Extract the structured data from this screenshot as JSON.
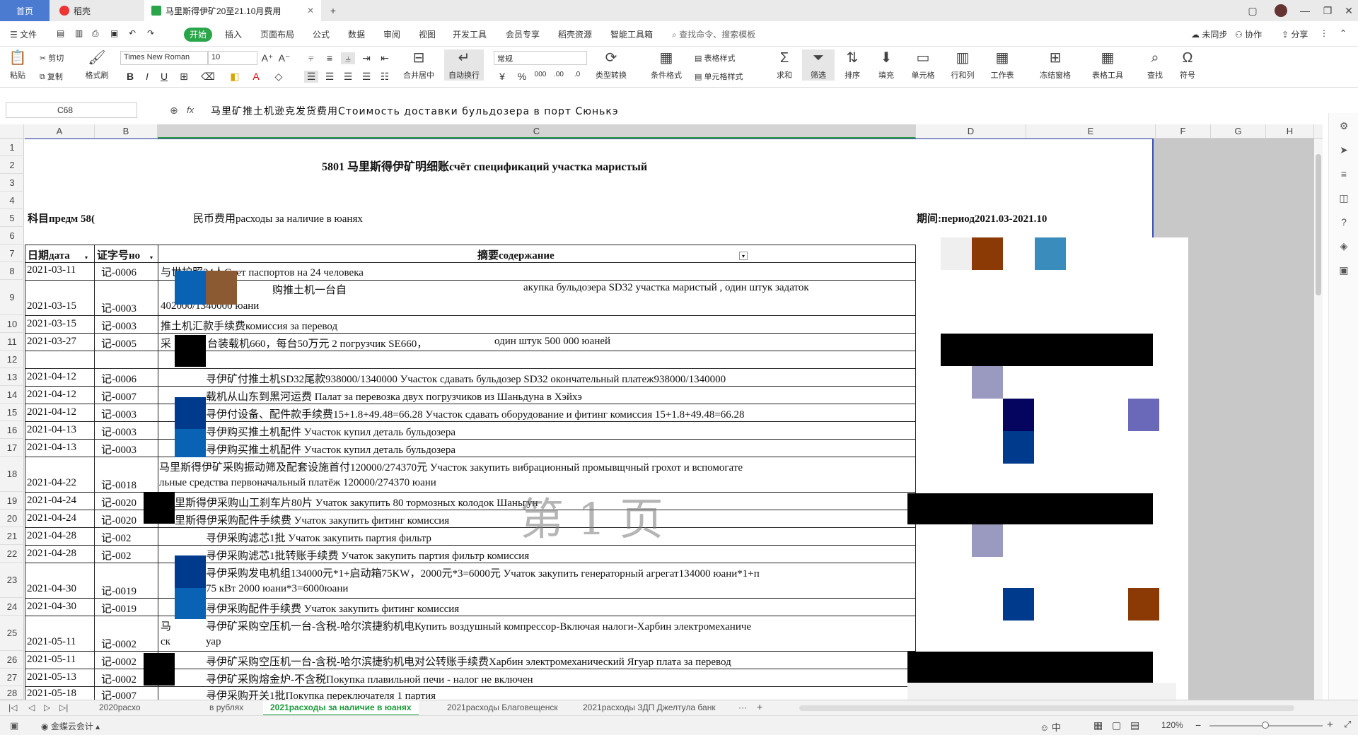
{
  "titlebar": {
    "tabs": [
      {
        "label": "首页"
      },
      {
        "label": "稻壳"
      },
      {
        "label": "马里斯得伊矿20至21.10月费用"
      }
    ],
    "new_tab": "+"
  },
  "menubar": {
    "file": "文件",
    "start": "开始",
    "items": [
      "插入",
      "页面布局",
      "公式",
      "数据",
      "审阅",
      "视图",
      "开发工具",
      "会员专享",
      "稻壳资源",
      "智能工具箱"
    ],
    "search_placeholder": "查找命令、搜索模板",
    "sync": "未同步",
    "collab": "协作",
    "share": "分享"
  },
  "toolbar": {
    "paste": "粘贴",
    "cut": "剪切",
    "copy": "复制",
    "format_painter": "格式刷",
    "font_name": "Times New Roman",
    "font_size": "10",
    "merge": "合并居中",
    "wrap": "自动换行",
    "number_format": "常规",
    "type_convert": "类型转换",
    "cond_format": "条件格式",
    "table_style": "表格样式",
    "cell_style": "单元格样式",
    "sum": "求和",
    "filter": "筛选",
    "sort": "排序",
    "fill": "填充",
    "cell": "单元格",
    "row_col": "行和列",
    "worksheet": "工作表",
    "freeze": "冻结窗格",
    "table_tools": "表格工具",
    "find": "查找",
    "symbol": "符号"
  },
  "formula": {
    "cell_ref": "C68",
    "fx": "fx",
    "content": "马里矿推土机逊克发货费用Стоимость доставки бульдозера в порт Сюнькэ"
  },
  "columns": [
    "A",
    "B",
    "C",
    "D",
    "E",
    "F",
    "G",
    "H"
  ],
  "rows": [
    "1",
    "2",
    "3",
    "4",
    "5",
    "6",
    "7",
    "8",
    "9",
    "10",
    "11",
    "12",
    "13",
    "14",
    "15",
    "16",
    "17",
    "18",
    "19",
    "20",
    "21",
    "22",
    "23",
    "24",
    "25",
    "26",
    "27",
    "28"
  ],
  "sheet": {
    "title": "5801 马里斯得伊矿明细账счёт спецификаций участка маристый",
    "subject": "科目предм 58(",
    "subject_rest": "民币费用расходы за наличие в юанях",
    "period": "期间:период2021.03-2021.10",
    "headers": {
      "date": "日期дата",
      "voucher": "证字号но",
      "summary": "摘要содержание"
    },
    "entries": [
      {
        "date": "2021-03-11",
        "voucher": "记-0006",
        "text": "与世护照24人Счет паспортов на 24 человека"
      },
      {
        "date": "2021-03-15",
        "voucher": "记-0003",
        "text": "购推土机一台自",
        "text2": "акупка бульдозера SD32 участка маристый ,  один штук задаток",
        "line2": "402000/1340000 юани"
      },
      {
        "date": "2021-03-15",
        "voucher": "记-0003",
        "text": "推土机汇款手续费комиссия за перевод"
      },
      {
        "date": "2021-03-27",
        "voucher": "记-0005",
        "text": "采",
        "text2": "台装载机660，每台50万元 2 погрузчик SE660，",
        "text3": "один  штук 500 000 юаней"
      },
      {
        "date": "",
        "voucher": "",
        "text": ""
      },
      {
        "date": "2021-04-12",
        "voucher": "记-0006",
        "text": "寻伊矿付推土机SD32尾款938000/1340000  Участок сдавать бульдозер SD32 окончательный платеж938000/1340000"
      },
      {
        "date": "2021-04-12",
        "voucher": "记-0007",
        "text": "载机从山东到黑河运费 Палат за перевозка двух погрузчиков из Шаньдуна в Хэйхэ"
      },
      {
        "date": "2021-04-12",
        "voucher": "记-0003",
        "text": "寻伊付设备、配件款手续费15+1.8+49.48=66.28 Участок сдавать оборудование и фитинг комиссия 15+1.8+49.48=66.28"
      },
      {
        "date": "2021-04-13",
        "voucher": "记-0003",
        "text": "寻伊购买推土机配件 Участок купил деталь бульдозера"
      },
      {
        "date": "2021-04-13",
        "voucher": "记-0003",
        "text": "寻伊购买推土机配件 Участок купил деталь бульдозера"
      },
      {
        "date": "2021-04-22",
        "voucher": "记-0018",
        "text": "马里斯得伊矿采购振动筛及配套设施首付120000/274370元 Участок закупить вибрационный промывщчный грохот и вспомогате",
        "line2": "льные средства первоначальный платёж 120000/274370 юани"
      },
      {
        "date": "2021-04-24",
        "voucher": "记-0020",
        "text": "里斯得伊采购山工刹车片80片 Учаток закупить 80 тормозных колодок Шаньгун"
      },
      {
        "date": "2021-04-24",
        "voucher": "记-0020",
        "text": "里斯得伊采购配件手续费 Учаток закупить фитинг комиссия"
      },
      {
        "date": "2021-04-28",
        "voucher": "记-002",
        "text": "寻伊采购滤芯1批 Учаток закупить партия фильтр"
      },
      {
        "date": "2021-04-28",
        "voucher": "记-002",
        "text": "寻伊采购滤芯1批转账手续费 Учаток закупить партия фильтр комиссия"
      },
      {
        "date": "2021-04-30",
        "voucher": "记-0019",
        "text": "寻伊采购发电机组134000元*1+启动箱75KW，2000元*3=6000元 Учаток закупить генераторный агрегат134000 юани*1+п",
        "line2": "75 кВт 2000 юани*3=6000юани"
      },
      {
        "date": "2021-04-30",
        "voucher": "记-0019",
        "text": "寻伊采购配件手续费 Учаток закупить фитинг комиссия"
      },
      {
        "date": "2021-05-11",
        "voucher": "记-0002",
        "text": "马",
        "text2": "寻伊矿采购空压机一台-含税-哈尔滨捷豹机电Купить воздушный компрессор-Включая налоги-Харбин электромеханиче",
        "line2a": "ск",
        "line2": "уар"
      },
      {
        "date": "2021-05-11",
        "voucher": "记-0002",
        "text": "寻伊矿采购空压机一台-含税-哈尔滨捷豹机电对公转账手续费Харбин электромеханический Ягуар плата за перевод"
      },
      {
        "date": "2021-05-13",
        "voucher": "记-0002",
        "text": "寻伊矿采购熔金炉-不含税Покупка плавильной печи - налог не включен"
      },
      {
        "date": "2021-05-18",
        "voucher": "记-0007",
        "text": "寻伊采购开关1批Покупка переключателя 1 партия"
      }
    ],
    "watermark": "第 1 页"
  },
  "sheet_tabs": [
    "2020расхо",
    "в рублях",
    "2021расходы за наличие в юанях",
    "2021расходы Благовещенск",
    "2021расходы ЗДП Джелтула банк"
  ],
  "sheet_tabs_more": "···",
  "status": {
    "app": "金蝶云会计",
    "ime": "中",
    "zoom": "120%"
  },
  "colors": {
    "accent_green": "#2aa54a",
    "home_tab": "#4a7bd0",
    "block_blue": "#0a62b4",
    "block_brown": "#8c5a32",
    "block_navy": "#003a8c",
    "block_darknavy": "#050560",
    "block_lavender": "#9a9ac0",
    "block_purple": "#6a68b8",
    "block_orange": "#8c3a05",
    "block_teal": "#3a8cbc"
  }
}
